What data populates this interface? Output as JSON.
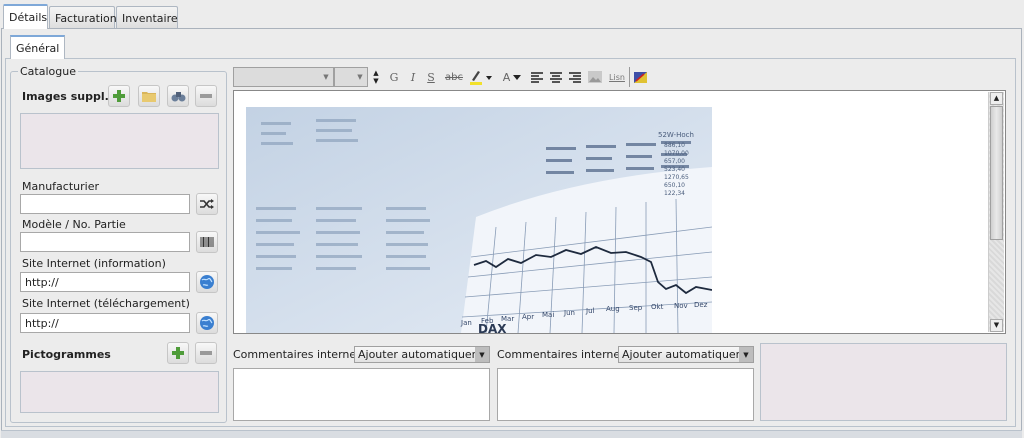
{
  "tabs": [
    {
      "label": "Détails"
    },
    {
      "label": "Facturation"
    },
    {
      "label": "Inventaire"
    }
  ],
  "subtab": {
    "label": "Général"
  },
  "catalogue": {
    "legend": "Catalogue",
    "images_label": "Images suppl.",
    "manufacturer_label": "Manufacturier",
    "manufacturer_value": "",
    "model_label": "Modèle / No. Partie",
    "model_value": "",
    "site_info_label": "Site Internet (information)",
    "site_info_value": "http://",
    "site_download_label": "Site Internet (téléchargement)",
    "site_download_value": "http://",
    "pictograms_label": "Pictogrammes"
  },
  "toolbar": {
    "bold": "G",
    "italic": "I",
    "underline": "S",
    "strike": "abc",
    "font_color": "A",
    "list": "Lisn"
  },
  "editor": {
    "image": {
      "months": [
        "Jan",
        "Feb",
        "Mar",
        "Apr",
        "Mai",
        "Jun",
        "Jul",
        "Aug",
        "Sep",
        "Okt",
        "Nov",
        "Dez"
      ],
      "x_title": "DAX",
      "table_header": "52W-Hoch",
      "table_values": [
        "886,10",
        "1070,00",
        "657,00",
        "523,40",
        "1270,65",
        "650,10",
        "122,34"
      ]
    }
  },
  "comments": [
    {
      "label": "Commentaires internes",
      "select_value": "Ajouter automatiqueme"
    },
    {
      "label": "Commentaires internes",
      "select_value": "Ajouter automatiqueme"
    }
  ]
}
